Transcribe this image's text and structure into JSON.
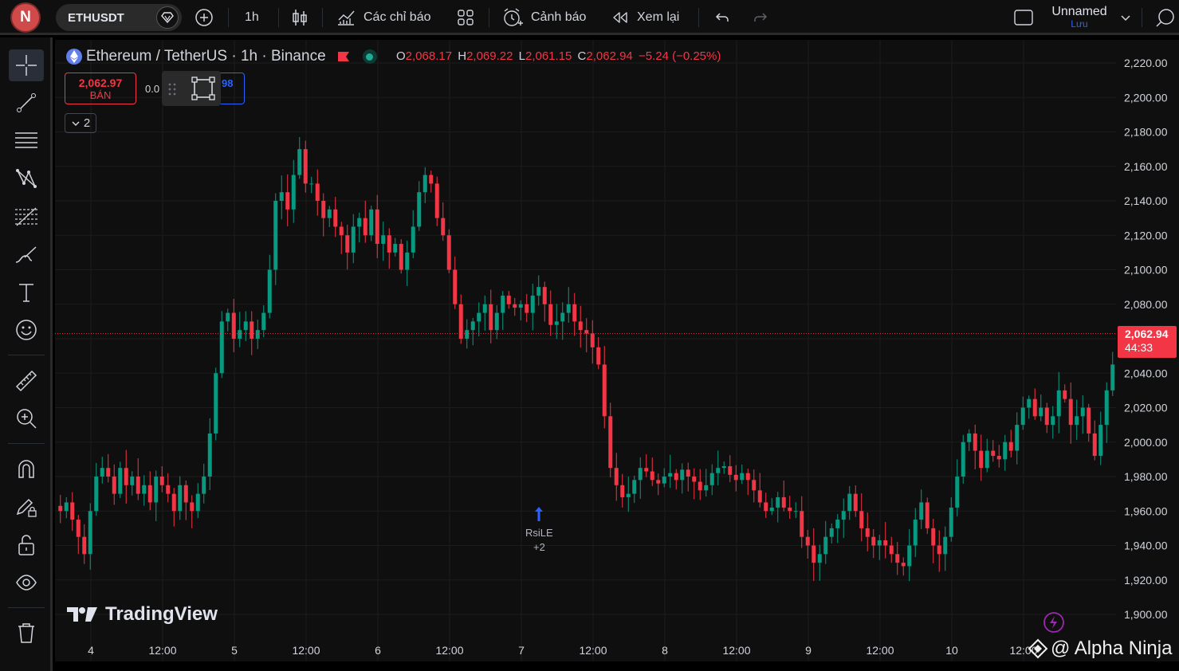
{
  "topbar": {
    "avatar": "N",
    "symbol": "ETHUSDT",
    "interval": "1h",
    "indicators": "Các chỉ báo",
    "alert": "Cảnh báo",
    "replay": "Xem lại",
    "layout_name": "Unnamed",
    "save": "Lưu"
  },
  "legend": {
    "title": "Ethereum / TetherUS · 1h · Binance",
    "o_key": "O",
    "o_val": "2,068.17",
    "h_key": "H",
    "h_val": "2,069.22",
    "l_key": "L",
    "l_val": "2,061.15",
    "c_key": "C",
    "c_val": "2,062.94",
    "change": "−5.24 (−0.25%)"
  },
  "trade": {
    "sell_price": "2,062.97",
    "sell_label": "BÁN",
    "spread": "0.0",
    "buy_price_partial": "98"
  },
  "collapse_count": "2",
  "price_tag": {
    "price": "2,062.94",
    "countdown": "44:33"
  },
  "signal": {
    "label": "RsiLE",
    "count": "+2"
  },
  "brand": "TradingView",
  "watermark": "@ Alpha Ninja",
  "colors": {
    "up": "#089981",
    "down": "#f23645",
    "accent": "#2962ff"
  },
  "chart_data": {
    "type": "candlestick",
    "y_ticks": [
      "2,220.00",
      "2,200.00",
      "2,180.00",
      "2,160.00",
      "2,140.00",
      "2,120.00",
      "2,100.00",
      "2,080.00",
      "2,060.00",
      "2,040.00",
      "2,020.00",
      "2,000.00",
      "1,980.00",
      "1,960.00",
      "1,940.00",
      "1,920.00",
      "1,900.00"
    ],
    "ylim": [
      1898,
      2226
    ],
    "x_ticks": [
      "4",
      "12:00",
      "5",
      "12:00",
      "6",
      "12:00",
      "7",
      "12:00",
      "8",
      "12:00",
      "9",
      "12:00",
      "10",
      "12:00"
    ],
    "last_price": 2062.94,
    "closes": [
      1960,
      1965,
      1955,
      1945,
      1935,
      1960,
      1980,
      1985,
      1980,
      1970,
      1985,
      1975,
      1980,
      1970,
      1975,
      1965,
      1980,
      1975,
      1970,
      1960,
      1975,
      1965,
      1960,
      1970,
      1980,
      2005,
      2040,
      2070,
      2075,
      2060,
      2065,
      2070,
      2060,
      2065,
      2075,
      2100,
      2140,
      2145,
      2135,
      2155,
      2170,
      2150,
      2150,
      2140,
      2130,
      2135,
      2125,
      2120,
      2110,
      2125,
      2130,
      2120,
      2135,
      2115,
      2120,
      2110,
      2115,
      2100,
      2110,
      2125,
      2145,
      2155,
      2150,
      2130,
      2120,
      2100,
      2080,
      2060,
      2065,
      2070,
      2075,
      2080,
      2065,
      2075,
      2085,
      2080,
      2078,
      2080,
      2075,
      2085,
      2090,
      2080,
      2068,
      2070,
      2075,
      2080,
      2070,
      2065,
      2063,
      2055,
      2045,
      2015,
      1985,
      1975,
      1968,
      1970,
      1978,
      1985,
      1983,
      1978,
      1976,
      1980,
      1982,
      1978,
      1984,
      1980,
      1977,
      1972,
      1975,
      1982,
      1985,
      1986,
      1981,
      1978,
      1982,
      1978,
      1972,
      1965,
      1960,
      1962,
      1968,
      1962,
      1960,
      1960,
      1945,
      1940,
      1930,
      1935,
      1945,
      1950,
      1955,
      1960,
      1970,
      1960,
      1950,
      1945,
      1940,
      1943,
      1940,
      1935,
      1930,
      1928,
      1940,
      1955,
      1965,
      1950,
      1940,
      1935,
      1945,
      1962,
      1980,
      2000,
      2005,
      1995,
      1985,
      1995,
      1992,
      1990,
      2000,
      1995,
      2010,
      2020,
      2025,
      2015,
      2020,
      2010,
      2015,
      2030,
      2025,
      2010,
      2015,
      2020,
      2005,
      1992,
      2010,
      2030,
      2045,
      2040,
      2045,
      2048,
      2050,
      2055,
      2055,
      2065,
      2072,
      2068
    ]
  }
}
